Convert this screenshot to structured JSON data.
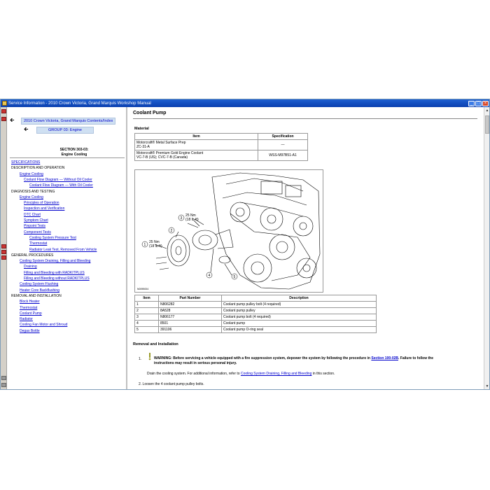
{
  "window": {
    "title": "Service Information - 2010 Crown Victoria, Grand Marquis Workshop Manual"
  },
  "nav": {
    "contents_label": "2010 Crown Victoria, Grand Marquis Contents/Index",
    "group_label": "GROUP 03: Engine"
  },
  "section": {
    "line1": "SECTION 303-03:",
    "line2": "Engine Cooling"
  },
  "toc": [
    {
      "label": "SPECIFICATIONS",
      "type": "link",
      "level": 0
    },
    {
      "label": "DESCRIPTION AND OPERATION",
      "type": "plain",
      "level": 0
    },
    {
      "label": "Engine Cooling",
      "type": "link",
      "level": 1
    },
    {
      "label": "Coolant Flow Diagram — Without Oil Cooler",
      "type": "link",
      "level": 2
    },
    {
      "label": "Coolant Flow Diagram — With Oil Cooler",
      "type": "link",
      "level": 3
    },
    {
      "label": "DIAGNOSIS AND TESTING",
      "type": "plain",
      "level": 0
    },
    {
      "label": "Engine Cooling",
      "type": "link",
      "level": 1
    },
    {
      "label": "Principles of Operation",
      "type": "link",
      "level": 2
    },
    {
      "label": "Inspection and Verification",
      "type": "link",
      "level": 2
    },
    {
      "label": "DTC Chart",
      "type": "link",
      "level": 2
    },
    {
      "label": "Symptom Chart",
      "type": "link",
      "level": 2
    },
    {
      "label": "Pinpoint Tests",
      "type": "link",
      "level": 2
    },
    {
      "label": "Component Tests",
      "type": "link",
      "level": 2
    },
    {
      "label": "Cooling System Pressure Test",
      "type": "link",
      "level": 3
    },
    {
      "label": "Thermostat",
      "type": "link",
      "level": 3
    },
    {
      "label": "Radiator Leak Test, Removed From Vehicle",
      "type": "link",
      "level": 3
    },
    {
      "label": "GENERAL PROCEDURES",
      "type": "plain",
      "level": 0
    },
    {
      "label": "Cooling System Draining, Filling and Bleeding",
      "type": "link",
      "level": 1
    },
    {
      "label": "Draining",
      "type": "link",
      "level": 2
    },
    {
      "label": "Filling and Bleeding with RADKITPLUS",
      "type": "link",
      "level": 2
    },
    {
      "label": "Filling and Bleeding without RADKITPLUS",
      "type": "link",
      "level": 2
    },
    {
      "label": "Cooling System Flushing",
      "type": "link",
      "level": 1
    },
    {
      "label": "Heater Core Backflushing",
      "type": "link",
      "level": 1
    },
    {
      "label": "REMOVAL AND INSTALLATION",
      "type": "plain",
      "level": 0
    },
    {
      "label": "Block Heater",
      "type": "link",
      "level": 1
    },
    {
      "label": "Thermostat",
      "type": "link",
      "level": 1
    },
    {
      "label": "Coolant Pump",
      "type": "link",
      "level": 1
    },
    {
      "label": "Radiator",
      "type": "link",
      "level": 1
    },
    {
      "label": "Cooling Fan Motor and Shroud",
      "type": "link",
      "level": 1
    },
    {
      "label": "Degas Bottle",
      "type": "link",
      "level": 1
    }
  ],
  "content": {
    "page_title": "Coolant Pump",
    "material_label": "Material",
    "material_table": {
      "headers": [
        "Item",
        "Specification"
      ],
      "rows": [
        {
          "item_line1": "Motorcraft® Metal Surface Prep",
          "item_line2": "ZC-31-A",
          "spec": "—"
        },
        {
          "item_line1": "Motorcraft® Premium Gold Engine Coolant",
          "item_line2": "VC-7-B (US); CVC-7-B (Canada)",
          "spec": "WSS-M97B51-A1"
        }
      ]
    },
    "diagram": {
      "callouts": [
        "1",
        "2",
        "3",
        "4",
        "5"
      ],
      "torque_a": "25 Nm",
      "torque_a_sub": "(18 lb-ft)",
      "torque_b": "25 Nm",
      "torque_b_sub": "(18 lb-ft)",
      "figure_id": "N0095004"
    },
    "parts_table": {
      "headers": [
        "Item",
        "Part Number",
        "Description"
      ],
      "rows": [
        {
          "item": "1",
          "part": "N806282",
          "desc": "Coolant pump pulley bolt (4 required)"
        },
        {
          "item": "2",
          "part": "8A528",
          "desc": "Coolant pump pulley"
        },
        {
          "item": "3",
          "part": "N806177",
          "desc": "Coolant pump bolt (4 required)"
        },
        {
          "item": "4",
          "part": "8501",
          "desc": "Coolant pump"
        },
        {
          "item": "5",
          "part": "391106",
          "desc": "Coolant pump O-ring seal"
        }
      ]
    },
    "removal_label": "Removal and Installation",
    "step1_num": "1.",
    "warning_prefix": "WARNING: Before servicing a vehicle equipped with a fire suppression system, depower the system by following the procedure in ",
    "warning_link": "Section 100-02B",
    "warning_suffix": ". Failure to follow the",
    "warning_line2": "instructions may result in serious personal injury.",
    "drain_prefix": "Drain the cooling system. For additional information, refer to ",
    "drain_link": "Cooling System Draining, Filling and Bleeding",
    "drain_suffix": " in this section.",
    "step2": "2.  Loosen the 4 coolant pump pulley bolts."
  }
}
